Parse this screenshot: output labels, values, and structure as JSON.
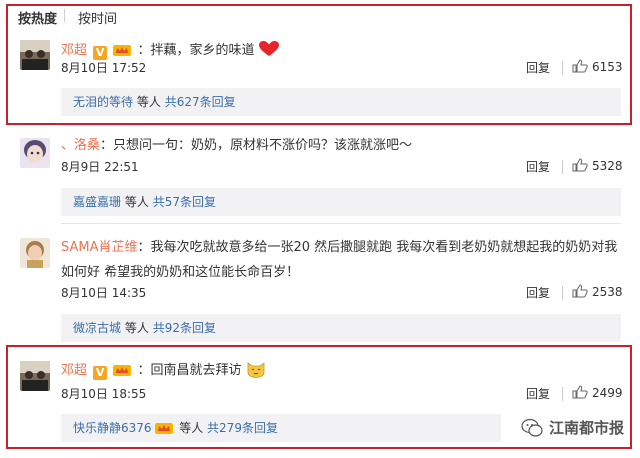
{
  "sort": {
    "hot": "按热度",
    "time": "按时间"
  },
  "comments": [
    {
      "user": "邓超",
      "text": "：拌藕，家乡的味道",
      "emoji": "heart",
      "date": "8月10日 17:52",
      "reply": "回复",
      "likes": "6153",
      "sub_user": "无泪的等待",
      "sub_mid": "等人",
      "sub_count": "共627条回复"
    },
    {
      "user": "、洛桑",
      "text": "：只想问一句：奶奶，原材料不涨价吗？该涨就涨吧～",
      "date": "8月9日 22:51",
      "reply": "回复",
      "likes": "5328",
      "sub_user": "嘉盛嘉珊",
      "sub_mid": "等人",
      "sub_count": "共57条回复"
    },
    {
      "user": "SAMA肖芷维",
      "text": "：我每次吃就故意多给一张20 然后撒腿就跑 我每次看到老奶奶就想起我的奶奶对我",
      "text2": "如何好 希望我的奶奶和这位能长命百岁！",
      "date": "8月10日 14:35",
      "reply": "回复",
      "likes": "2538",
      "sub_user": "微凉古城",
      "sub_mid": "等人",
      "sub_count": "共92条回复"
    },
    {
      "user": "邓超",
      "text": "：回南昌就去拜访",
      "emoji": "cat",
      "date": "8月10日 18:55",
      "reply": "回复",
      "likes": "2499",
      "sub_user": "快乐静静6376",
      "sub_mid": "等人",
      "sub_count": "共279条回复"
    }
  ],
  "watermark": "江南都市报",
  "colors": {
    "frame": "#c8202f",
    "user": "#eb7350",
    "link": "#3a6ea8"
  }
}
